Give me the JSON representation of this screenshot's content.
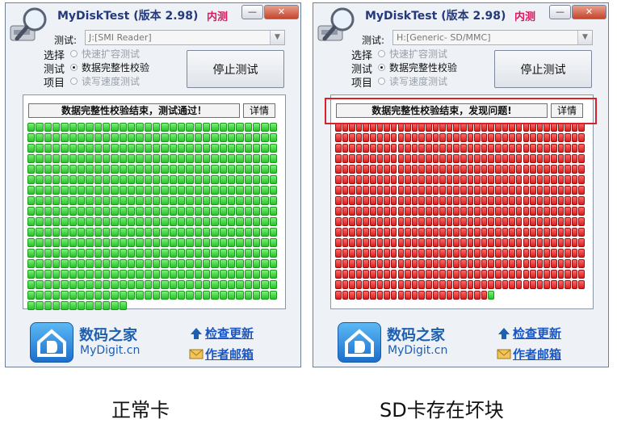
{
  "windows": [
    {
      "title": "MyDiskTest (版本 2.98)",
      "beta_label": "内测",
      "minimize_label": "—",
      "close_label": "✕",
      "drive_label": "测试:",
      "drive_value": "J:[SMI Reader]",
      "mode_label": [
        "选择",
        "测试",
        "项目"
      ],
      "radio_options": [
        "快速扩容测试",
        "数据完整性校验",
        "读写速度测试"
      ],
      "selected_option": 1,
      "stop_button": "停止测试",
      "status_text": "数据完整性校验结束，测试通过！",
      "details_button": "详情",
      "grid": {
        "columns": 30,
        "full_rows": 17,
        "last_row_cells": 12,
        "bad_rows": 0,
        "bad_cells": 0,
        "status": "all-good"
      },
      "brand_cn": "数码之家",
      "brand_en": "MyDigit.cn",
      "link_update": "检查更新",
      "link_mail": "作者邮箱"
    },
    {
      "title": "MyDiskTest (版本 2.98)",
      "beta_label": "内测",
      "minimize_label": "—",
      "close_label": "✕",
      "drive_label": "测试:",
      "drive_value": "H:[Generic- SD/MMC]",
      "mode_label": [
        "选择",
        "测试",
        "项目"
      ],
      "radio_options": [
        "快速扩容测试",
        "数据完整性校验",
        "读写速度测试"
      ],
      "selected_option": 1,
      "stop_button": "停止测试",
      "status_text": "数据完整性校验结束，发现问题!",
      "details_button": "详情",
      "grid": {
        "columns": 36,
        "full_rows": 16,
        "last_row_cells": 23,
        "bad_rows": 16,
        "bad_cells": 22,
        "status": "errors"
      },
      "brand_cn": "数码之家",
      "brand_en": "MyDigit.cn",
      "link_update": "检查更新",
      "link_mail": "作者邮箱"
    }
  ],
  "captions": [
    "正常卡",
    "SD卡存在坏块"
  ],
  "colors": {
    "good": "#2ecc40",
    "bad": "#e02020",
    "highlight": "#d6232b",
    "title": "#243a7a",
    "link": "#1a57c2"
  }
}
